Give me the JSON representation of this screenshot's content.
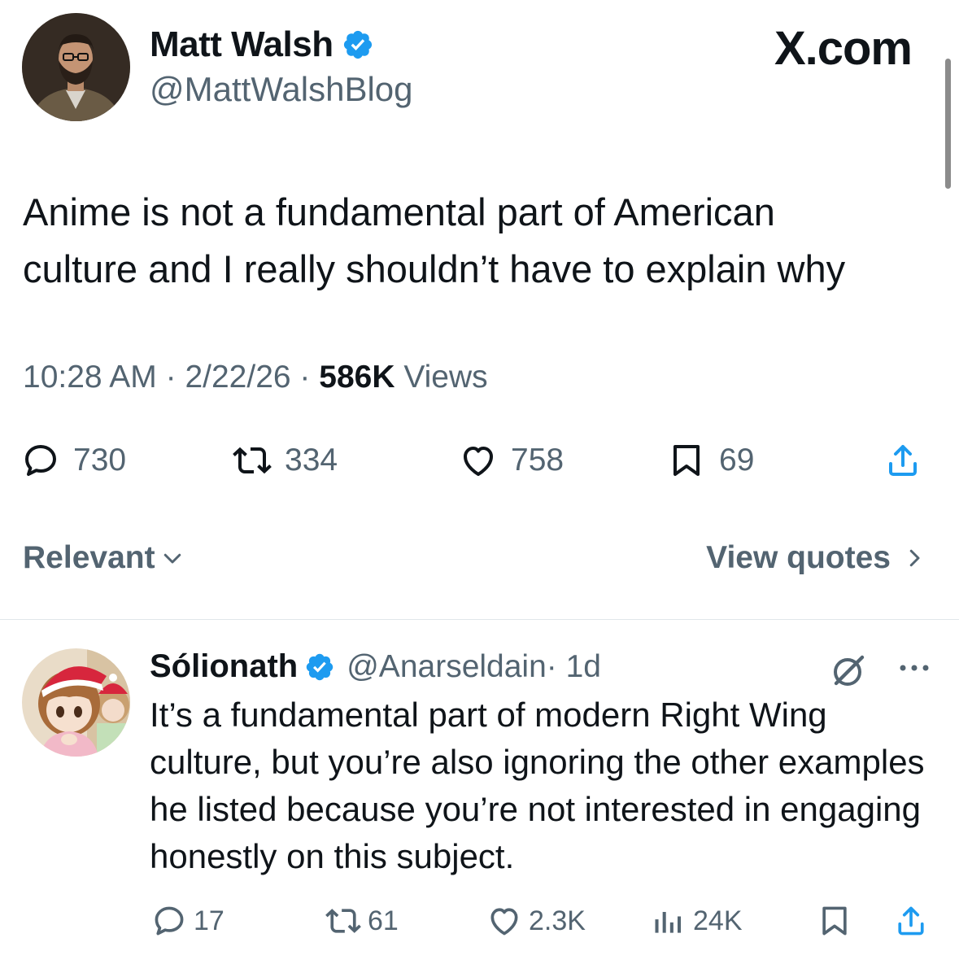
{
  "header": {
    "brand": "X.com",
    "author_name": "Matt Walsh",
    "author_handle": "@MattWalshBlog"
  },
  "tweet": {
    "text_line1": "Anime is not a fundamental part of American",
    "text_line2": "culture and I really shouldn’t have to explain why",
    "time": "10:28 AM",
    "date": "2/22/26",
    "views_count": "586K",
    "views_label": "Views",
    "separator": " · ",
    "actions": {
      "replies": "730",
      "reposts": "334",
      "likes": "758",
      "bookmarks": "69"
    }
  },
  "replies_bar": {
    "sort_label": "Relevant",
    "view_quotes_label": "View quotes"
  },
  "reply": {
    "author_name": "Sólionath",
    "author_handle": "@Anarseldain",
    "time": " · 1d",
    "text": "It’s a fundamental part of modern Right Wing culture, but you’re also ignoring the other examples he listed because you’re not interested in engaging honestly on this subject.",
    "actions": {
      "replies": "17",
      "reposts": "61",
      "likes": "2.3K",
      "views": "24K"
    }
  },
  "colors": {
    "text_primary": "#0f1419",
    "text_secondary": "#536471",
    "verified_blue": "#1d9bf0",
    "divider": "#e1e6ea"
  },
  "icons": [
    "verified-badge-icon",
    "reply-icon",
    "repost-icon",
    "like-icon",
    "bookmark-icon",
    "share-icon",
    "chevron-down-icon",
    "chevron-right-icon",
    "grok-icon",
    "more-icon",
    "views-icon"
  ]
}
